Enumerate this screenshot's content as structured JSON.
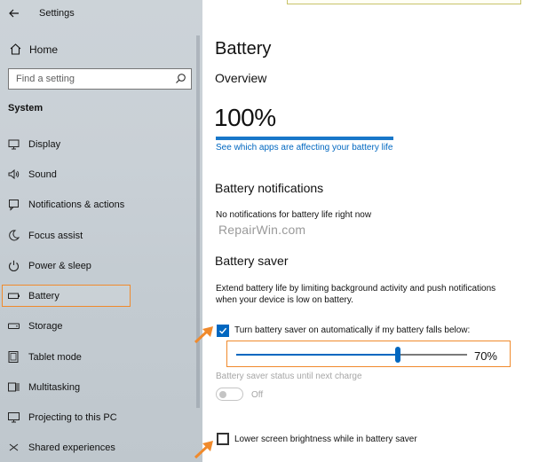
{
  "window": {
    "title": "Settings"
  },
  "sidebar": {
    "home_label": "Home",
    "search": {
      "placeholder": "Find a setting"
    },
    "section_label": "System",
    "items": [
      {
        "label": "Display",
        "icon": "monitor-icon"
      },
      {
        "label": "Sound",
        "icon": "speaker-icon"
      },
      {
        "label": "Notifications & actions",
        "icon": "notification-icon"
      },
      {
        "label": "Focus assist",
        "icon": "moon-icon"
      },
      {
        "label": "Power & sleep",
        "icon": "power-icon"
      },
      {
        "label": "Battery",
        "icon": "battery-icon",
        "selected": true
      },
      {
        "label": "Storage",
        "icon": "storage-icon"
      },
      {
        "label": "Tablet mode",
        "icon": "tablet-icon"
      },
      {
        "label": "Multitasking",
        "icon": "multitasking-icon"
      },
      {
        "label": "Projecting to this PC",
        "icon": "projecting-icon"
      },
      {
        "label": "Shared experiences",
        "icon": "shared-icon"
      }
    ]
  },
  "main": {
    "title": "Battery",
    "overview": {
      "heading": "Overview",
      "percent": "100%",
      "battery_level": 1.0,
      "link": "See which apps are affecting your battery life"
    },
    "notifications": {
      "heading": "Battery notifications",
      "text": "No notifications for battery life right now"
    },
    "watermark": "RepairWin.com",
    "saver": {
      "heading": "Battery saver",
      "description": "Extend battery life by limiting background activity and push notifications when your device is low on battery.",
      "auto_checkbox_label": "Turn battery saver on automatically if my battery falls below:",
      "auto_checked": true,
      "threshold_value": 0.7,
      "threshold_display": "70%",
      "status_label": "Battery saver status until next charge",
      "toggle_label": "Off",
      "brightness_checkbox_label": "Lower screen brightness while in battery saver",
      "brightness_checked": false
    }
  },
  "colors": {
    "accent": "#0067c0",
    "highlight": "#f08a2c",
    "overview_bar": "#1877c9"
  }
}
